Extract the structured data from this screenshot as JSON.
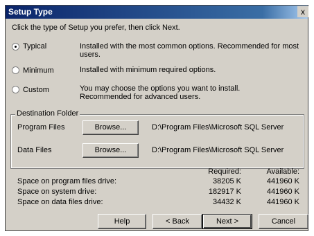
{
  "window": {
    "title": "Setup Type",
    "close_glyph": "x"
  },
  "instruction": "Click the type of Setup you prefer, then click Next.",
  "options": [
    {
      "label": "Typical",
      "description": "Installed with the most common options. Recommended for most users.",
      "selected": true
    },
    {
      "label": "Minimum",
      "description": "Installed with minimum required options.",
      "selected": false
    },
    {
      "label": "Custom",
      "description": "You may choose the options you want to install. Recommended for advanced users.",
      "selected": false
    }
  ],
  "destination": {
    "title": "Destination Folder",
    "rows": [
      {
        "label": "Program Files",
        "button": "Browse...",
        "path": "D:\\Program Files\\Microsoft SQL Server"
      },
      {
        "label": "Data Files",
        "button": "Browse...",
        "path": "D:\\Program Files\\Microsoft SQL Server"
      }
    ]
  },
  "space": {
    "required_header": "Required:",
    "available_header": "Available:",
    "rows": [
      {
        "label": "Space on program files drive:",
        "required": "38205 K",
        "available": "441960 K"
      },
      {
        "label": "Space on system drive:",
        "required": "182917 K",
        "available": "441960 K"
      },
      {
        "label": "Space on data files drive:",
        "required": "34432 K",
        "available": "441960 K"
      }
    ]
  },
  "buttons": {
    "help": "Help",
    "back": "< Back",
    "next": "Next >",
    "cancel": "Cancel"
  }
}
